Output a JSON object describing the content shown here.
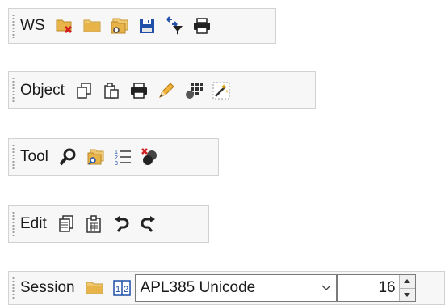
{
  "toolbars": {
    "ws": {
      "label": "WS",
      "buttons": [
        "clear-ws-icon",
        "open-folder-icon",
        "copy-folder-icon",
        "save-icon",
        "filter-icon",
        "print-icon"
      ]
    },
    "object": {
      "label": "Object",
      "buttons": [
        "copy-object-icon",
        "paste-object-icon",
        "print-icon",
        "edit-pencil-icon",
        "grid-icon",
        "magic-wand-icon"
      ]
    },
    "tool": {
      "label": "Tool",
      "buttons": [
        "search-icon",
        "folder-search-icon",
        "numbered-list-icon",
        "delete-objects-icon"
      ]
    },
    "edit": {
      "label": "Edit",
      "buttons": [
        "copy-icon",
        "paste-icon",
        "undo-icon",
        "redo-icon"
      ]
    },
    "session": {
      "label": "Session",
      "buttons": [
        "open-folder-icon",
        "keyboard-layout-icon"
      ],
      "font_select": "APL385 Unicode",
      "font_size": "16"
    }
  },
  "colors": {
    "toolbar_bg": "#f7f7f7",
    "border": "#d2d2d2",
    "folder": "#e8b44a",
    "blue": "#1f4fa8",
    "red": "#d21e1e"
  }
}
